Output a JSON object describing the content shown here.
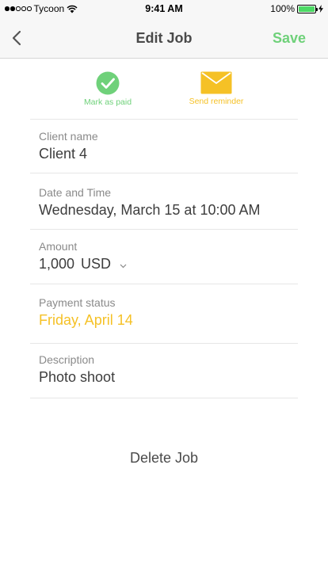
{
  "status_bar": {
    "carrier": "Tycoon",
    "time": "9:41 AM",
    "battery_percent": "100%",
    "battery_level": 1.0
  },
  "nav": {
    "back_icon": "chevron-left-icon",
    "title": "Edit Job",
    "save_label": "Save"
  },
  "actions": {
    "mark_paid": {
      "icon": "checkmark-circle-icon",
      "label": "Mark as paid"
    },
    "send_reminder": {
      "icon": "envelope-icon",
      "label": "Send reminder"
    }
  },
  "fields": {
    "client": {
      "label": "Client name",
      "value": "Client 4"
    },
    "date_time": {
      "label": "Date and Time",
      "value": "Wednesday, March 15 at 10:00 AM"
    },
    "amount": {
      "label": "Amount",
      "value": "1,000",
      "currency": "USD"
    },
    "payment_status": {
      "label": "Payment status",
      "value": "Friday, April 14"
    },
    "description": {
      "label": "Description",
      "value": "Photo shoot"
    }
  },
  "delete_label": "Delete Job",
  "colors": {
    "accent_green": "#6fd17a",
    "accent_yellow": "#f5c126",
    "text": "#3d3d3d",
    "muted": "#8a8a8a"
  }
}
